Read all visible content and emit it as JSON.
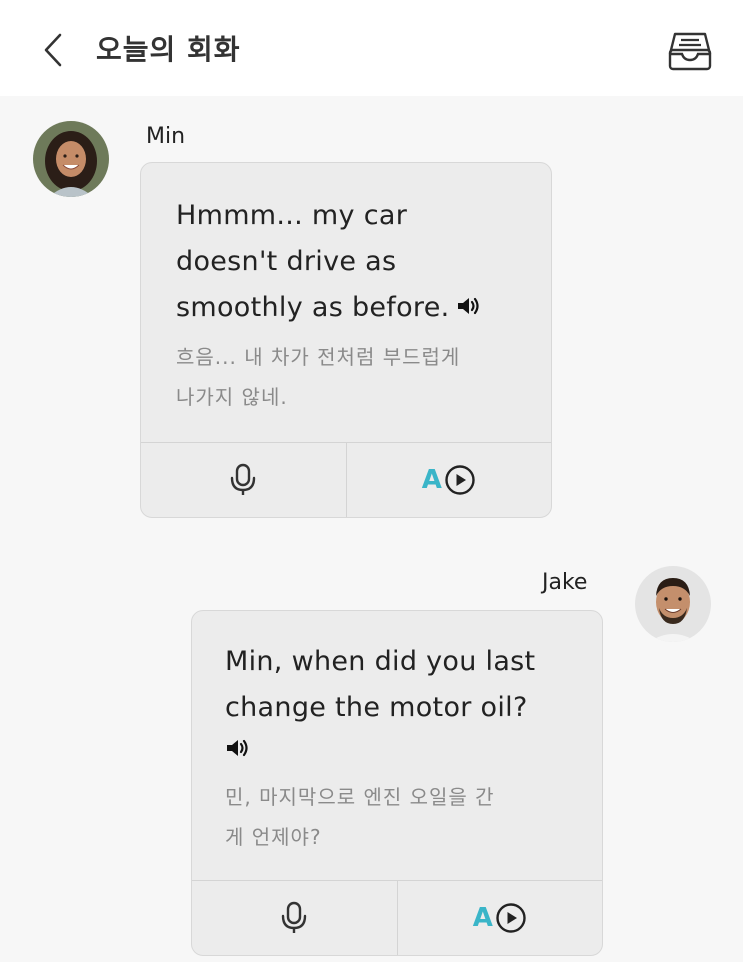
{
  "header": {
    "title": "오늘의 회화",
    "back_icon": "chevron-left-icon",
    "inbox_icon": "inbox-tray-icon"
  },
  "messages": [
    {
      "sender": "Min",
      "avatar": "female-avatar",
      "text_en": [
        "Hmmm... my car",
        "doesn't drive as",
        "smoothly as before."
      ],
      "text_ko": [
        "흐음... 내 차가 전처럼 부드럽게",
        "나가지 않네."
      ],
      "speaker_icon": "speaker-icon",
      "record_icon": "microphone-icon",
      "play_label": "A",
      "play_icon": "play-circle-icon"
    },
    {
      "sender": "Jake",
      "avatar": "male-avatar",
      "text_en": [
        "Min, when did you last",
        "change the motor oil?"
      ],
      "text_ko": [
        "민, 마지막으로 엔진 오일을 간",
        "게 언제야?"
      ],
      "speaker_icon": "speaker-icon",
      "record_icon": "microphone-icon",
      "play_label": "A",
      "play_icon": "play-circle-icon"
    }
  ],
  "colors": {
    "bubble_bg": "#ececec",
    "accent": "#3ab5c8",
    "translation_text": "#8a8a8a"
  }
}
